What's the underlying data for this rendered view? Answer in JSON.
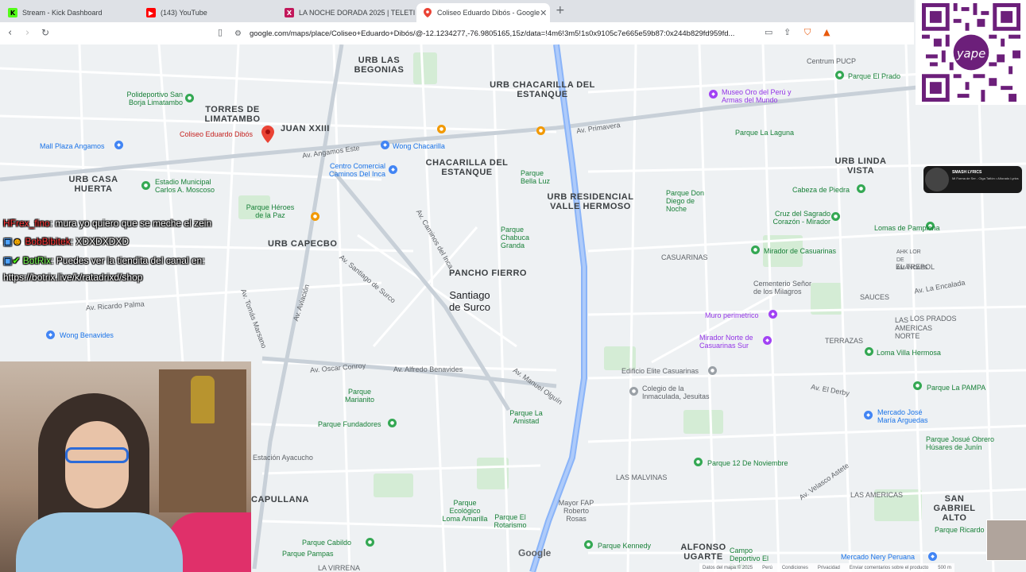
{
  "tabs": [
    {
      "title": "Stream - Kick Dashboard",
      "icon": "kick-icon",
      "color": "#53fc18"
    },
    {
      "title": "(143) YouTube",
      "icon": "youtube-icon",
      "color": "#ff0000"
    },
    {
      "title": "LA NOCHE DORADA 2025 | TELETICA",
      "icon": "teletica-icon",
      "color": "#c2185b"
    },
    {
      "title": "Coliseo Eduardo Dibós - Google",
      "icon": "google-maps-icon",
      "color": "#34a853"
    }
  ],
  "url": "google.com/maps/place/Coliseo+Eduardo+Dibós/@-12.1234277,-76.9805165,15z/data=!4m6!3m5!1s0x9105c7e665e59b87:0x244b829fd959fd...",
  "map": {
    "districts": [
      "URB LAS BEGONIAS",
      "URB CHACARILLA DEL ESTANQUE",
      "TORRES DE LIMATAMBO",
      "JUAN XXIII",
      "CHACARILLA DEL ESTANQUE",
      "URB CASA HUERTA",
      "URB RESIDENCIAL VALLE HERMOSO",
      "URB CAPECBO",
      "PANCHO FIERRO",
      "URB LINDA VISTA",
      "CAPULLANA",
      "ALFONSO UGARTE",
      "SAN GABRIEL ALTO"
    ],
    "main_label": "Santiago de Surco",
    "pois": [
      "Coliseo Eduardo Dibós",
      "Wong Chacarilla",
      "Centro Comercial Caminos Del Inca",
      "Polideportivo San Borja Limatambo",
      "Mall Plaza Angamos",
      "Estadio Municipal Carlos A. Moscoso",
      "Parque Héroes de la Paz",
      "Museo Oro del Perú y Armas del Mundo",
      "Parque El Prado",
      "Centrum PUCP",
      "Parque La Laguna",
      "Parque Bella Luz",
      "Parque Chabuca Granda",
      "Parque Don Diego de Noche",
      "Cabeza de Piedra",
      "Cruz del Sagrado Corazón - Mirador",
      "Lomas de Pamplona",
      "Mirador de Casuarinas",
      "Cementerio Señor de los Milagros",
      "Muro perimetrico",
      "Mirador Norte de Casuarinas Sur",
      "Loma Villa Hermosa",
      "Edificio Elite Casuarinas",
      "Colegio de la Inmaculada, Jesuitas",
      "Parque La PAMPA",
      "Mercado José María Arguedas",
      "Wong Benavides",
      "Parque Fundadores",
      "Parque 12 De Noviembre",
      "Parque Marianito",
      "Parque La Amistad",
      "Parque Ecológico Loma Amarilla",
      "Mayor FAP Roberto Rosas",
      "Parque Kennedy",
      "Parque Cabildo",
      "Parque Pampas",
      "Parque El Rotarismo",
      "Parque Ricardo Palma",
      "Parque Josué Obrero Húsares de Junín",
      "Mercado Nery Peruana",
      "Estación Ayacucho",
      "Campo Deportivo El Delfín"
    ],
    "streets": [
      "Av. Angamos Este",
      "Av. Primavera",
      "Av. Aviación",
      "Av. Caminos del Inca",
      "Av. Alfredo Benavides",
      "Av. Ricardo Palma",
      "Av. Tomás Marsano",
      "Av. Oscar Conroy",
      "Av. Santiago de Surco",
      "Av. Manuel Olguín",
      "Av. Velasco Astete",
      "Av. El Derby",
      "Av. La Encalada"
    ],
    "areas": [
      "LAS MALVINAS",
      "LAS AMERICAS",
      "EL TREBOL",
      "SAUCES",
      "CASUARINAS",
      "AHK LOR DE AMANCAES",
      "TERRAZAS",
      "LOS PRADOS",
      "LA VIRRENA",
      "LAS AMERICAS NORTE"
    ],
    "footer": [
      "Datos del mapa © 2025",
      "Perú",
      "Condiciones",
      "Privacidad",
      "Enviar comentarios sobre el producto",
      "500 m"
    ],
    "brand": "Google"
  },
  "chat": [
    {
      "user": "HFrex_fino",
      "user_color": "#ff3b3b",
      "message": ": mura yo quiero que se meche el zein"
    },
    {
      "user": "BobBibitek",
      "user_color": "#ff3b3b",
      "message": ": XDXDXDXD"
    },
    {
      "user": "BotRix",
      "user_color": "#7cff58",
      "message": ": Puedes ver la tiendita del canal en:"
    },
    {
      "user": "",
      "user_color": "#ffffff",
      "message": "https://botrix.live/k/ratadrixd/shop"
    }
  ],
  "qr": {
    "badge": "yape",
    "color": "#6c1f7a"
  },
  "now_playing": {
    "title": "SMASH LYRICS",
    "sub": "Mi Forma de Ser - Olga Tañón • Añorado Lyrics"
  }
}
